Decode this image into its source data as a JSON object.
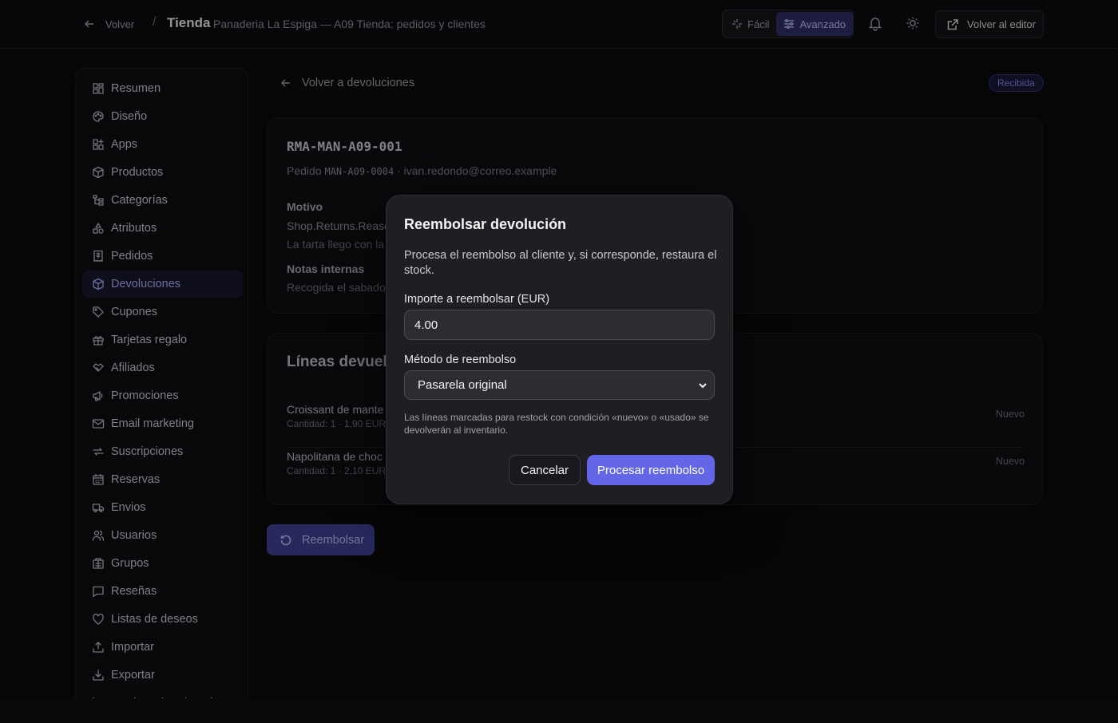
{
  "header": {
    "back_label": "Volver",
    "separator": "/",
    "store_title": "Tienda",
    "store_subtitle": "Panaderia La Espiga — A09 Tienda: pedidos y clientes",
    "mode_easy": "Fácil",
    "mode_advanced": "Avanzado",
    "editor_button": "Volver al editor"
  },
  "sidebar": {
    "items": [
      {
        "label": "Resumen",
        "icon": "grid-icon"
      },
      {
        "label": "Diseño",
        "icon": "palette-icon"
      },
      {
        "label": "Apps",
        "icon": "apps-icon"
      },
      {
        "label": "Productos",
        "icon": "box-icon"
      },
      {
        "label": "Categorías",
        "icon": "tree-icon"
      },
      {
        "label": "Atributos",
        "icon": "shapes-icon"
      },
      {
        "label": "Pedidos",
        "icon": "receipt-icon"
      },
      {
        "label": "Devoluciones",
        "icon": "box-return-icon",
        "active": true
      },
      {
        "label": "Cupones",
        "icon": "tag-icon"
      },
      {
        "label": "Tarjetas regalo",
        "icon": "gift-icon"
      },
      {
        "label": "Afiliados",
        "icon": "handshake-icon"
      },
      {
        "label": "Promociones",
        "icon": "megaphone-icon"
      },
      {
        "label": "Email marketing",
        "icon": "mail-icon"
      },
      {
        "label": "Suscripciones",
        "icon": "repeat-icon"
      },
      {
        "label": "Reservas",
        "icon": "calendar-icon"
      },
      {
        "label": "Envios",
        "icon": "truck-icon"
      },
      {
        "label": "Usuarios",
        "icon": "users-icon"
      },
      {
        "label": "Grupos",
        "icon": "building-icon"
      },
      {
        "label": "Reseñas",
        "icon": "message-icon"
      },
      {
        "label": "Listas de deseos",
        "icon": "heart-icon"
      },
      {
        "label": "Importar",
        "icon": "upload-icon"
      },
      {
        "label": "Exportar",
        "icon": "download-icon"
      },
      {
        "label": "Carritos abandonados",
        "icon": "cart-icon"
      }
    ]
  },
  "main": {
    "back_label": "Volver a devoluciones",
    "status_badge": "Recibida",
    "rma_code": "RMA-MAN-A09-001",
    "order_prefix": "Pedido",
    "order_code": "MAN-A09-0004",
    "order_email": "· ivan.redondo@correo.example",
    "reason_label": "Motivo",
    "reason_value": "Shop.Returns.Reaso",
    "reason_detail": "La tarta llego con la",
    "notes_label": "Notas internas",
    "notes_value": "Recogida el sabado",
    "lines_title": "Líneas devuelta",
    "lines": [
      {
        "name": "Croissant de mante",
        "meta": "Cantidad: 1 · 1,90 EUR c",
        "condition": "Nuevo"
      },
      {
        "name": "Napolitana de choc",
        "meta": "Cantidad: 1 · 2,10 EUR c",
        "condition": "Nuevo"
      }
    ],
    "refund_button": "Reembolsar"
  },
  "modal": {
    "title": "Reembolsar devolución",
    "description": "Procesa el reembolso al cliente y, si corresponde, restaura el stock.",
    "amount_label": "Importe a reembolsar (EUR)",
    "amount_value": "4.00",
    "method_label": "Método de reembolso",
    "method_value": "Pasarela original",
    "note": "Las líneas marcadas para restock con condición «nuevo» o «usado» se devolverán al inventario.",
    "cancel_button": "Cancelar",
    "process_button": "Procesar reembolso"
  },
  "colors": {
    "accent": "#6466e8",
    "active_nav": "#a5a8f0",
    "background": "#0a0a0c"
  }
}
